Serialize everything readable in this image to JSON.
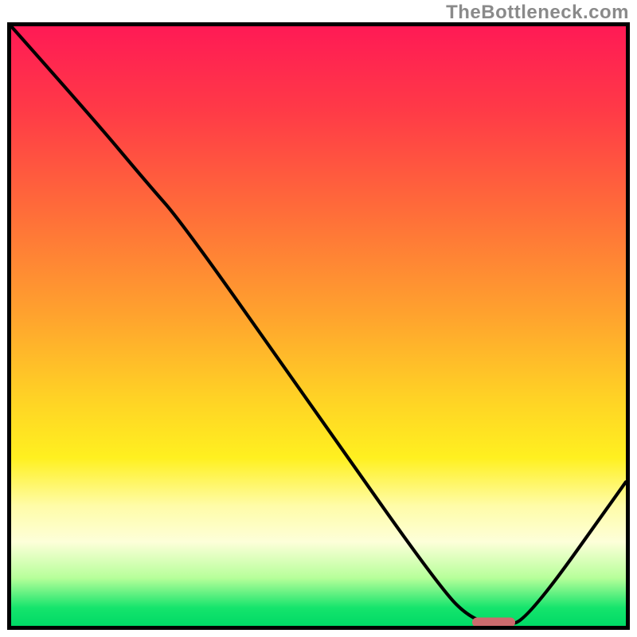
{
  "watermark": "TheBottleneck.com",
  "chart_data": {
    "type": "line",
    "title": "",
    "xlabel": "",
    "ylabel": "",
    "xlim": [
      0,
      100
    ],
    "ylim": [
      0,
      100
    ],
    "grid": false,
    "series": [
      {
        "name": "curve",
        "x": [
          0,
          13,
          22,
          28,
          50,
          70,
          75,
          80,
          84,
          100
        ],
        "values": [
          100,
          85,
          74,
          67,
          35,
          6,
          1,
          0,
          1,
          24
        ]
      }
    ],
    "marker": {
      "name": "flat-segment",
      "x_start": 75,
      "x_end": 82,
      "y": 0.6,
      "color": "#cc6b6d"
    },
    "background": {
      "type": "vertical-gradient",
      "stops": [
        {
          "pos": 0.0,
          "color": "#ff1a55"
        },
        {
          "pos": 0.48,
          "color": "#ffa22e"
        },
        {
          "pos": 0.72,
          "color": "#fff020"
        },
        {
          "pos": 0.97,
          "color": "#15e46c"
        },
        {
          "pos": 1.0,
          "color": "#00da66"
        }
      ]
    }
  }
}
